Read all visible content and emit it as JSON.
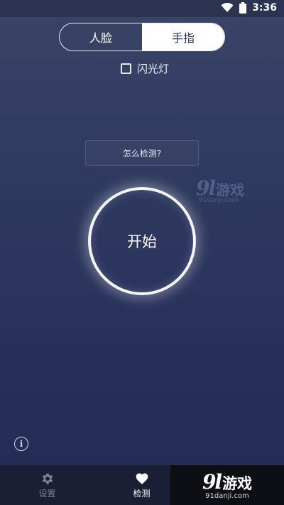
{
  "status_bar": {
    "time": "3:36",
    "wifi_icon": "wifi-icon",
    "battery_icon": "battery-icon"
  },
  "mode_tabs": [
    {
      "label": "人脸",
      "selected": false
    },
    {
      "label": "手指",
      "selected": true
    }
  ],
  "flash": {
    "label": "闪光灯",
    "checked": false
  },
  "howto_label": "怎么检测?",
  "start_label": "开始",
  "info_icon": "info-icon",
  "bottom_nav": [
    {
      "label": "设置",
      "icon": "gear-icon",
      "active": false
    },
    {
      "label": "检测",
      "icon": "heart-icon",
      "active": true
    }
  ],
  "watermark": {
    "logo_num": "9l",
    "logo_text": "游戏",
    "url": "91danji.com"
  }
}
